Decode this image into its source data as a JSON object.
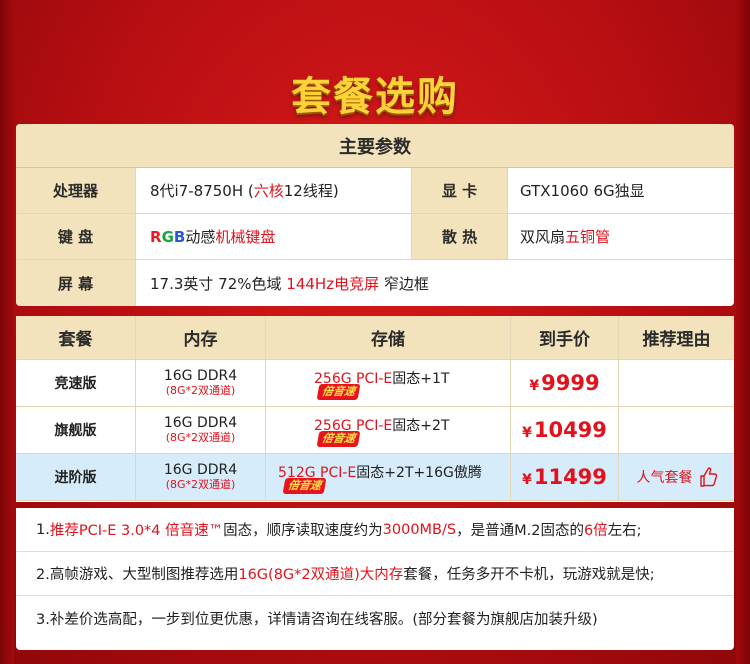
{
  "title": "套餐选购",
  "params": {
    "header": "主要参数",
    "rows": [
      {
        "label": "处理器",
        "value_a": "8代i7-8750H (",
        "value_red": "六核",
        "value_b": "12线程)",
        "label2": "显 卡",
        "value2": "GTX1060 6G独显"
      },
      {
        "label": "键 盘",
        "rgb_r": "R",
        "rgb_g": "G",
        "rgb_b": "B",
        "value_a": "动感",
        "value_red": "机械键盘",
        "label2": "散 热",
        "value2_a": "双风扇",
        "value2_red": "五铜管"
      },
      {
        "label": "屏 幕",
        "value_a": "17.3英寸 72%色域 ",
        "value_red": "144Hz电竞屏",
        "value_b": " 窄边框"
      }
    ]
  },
  "packages": {
    "headers": [
      "套餐",
      "内存",
      "存储",
      "到手价",
      "推荐理由"
    ],
    "rows": [
      {
        "name": "竞速版",
        "mem": "16G DDR4",
        "mem_sub": "(8G*2双通道)",
        "storage_red": "256G PCI-E",
        "storage_rest": "固态+1T",
        "badge": "倍音速",
        "currency": "¥",
        "price": "9999",
        "reason": ""
      },
      {
        "name": "旗舰版",
        "mem": "16G DDR4",
        "mem_sub": "(8G*2双通道)",
        "storage_red": "256G PCI-E",
        "storage_rest": "固态+2T",
        "badge": "倍音速",
        "currency": "¥",
        "price": "10499",
        "reason": ""
      },
      {
        "name": "进阶版",
        "mem": "16G DDR4",
        "mem_sub": "(8G*2双通道)",
        "storage_red": "512G PCI-E",
        "storage_rest": "固态+2T+16G傲腾",
        "badge": "倍音速",
        "currency": "¥",
        "price": "11499",
        "reason": "人气套餐"
      }
    ]
  },
  "notes": [
    {
      "a": "1.",
      "red1": "推荐PCI-E 3.0*4 倍音速™",
      "b": "固态，顺序读取速度约为",
      "red2": "3000MB/S",
      "c": "，是普通M.2固态的",
      "red3": "6倍",
      "d": "左右;"
    },
    {
      "a": "2.高帧游戏、大型制图推荐选用",
      "red1": "16G(8G*2双通道)大内存",
      "b": "套餐，任务多开不卡机，玩游戏就是快;"
    },
    {
      "a": "3.补差价选高配，一步到位更优惠，详情请咨询在线客服。(部分套餐为旗舰店加装升级)"
    }
  ],
  "colors": {
    "accent": "#e2121c",
    "header_bg": "#f3e3bc",
    "highlight_bg": "#d6ecfb",
    "title": "#ffd23a"
  }
}
